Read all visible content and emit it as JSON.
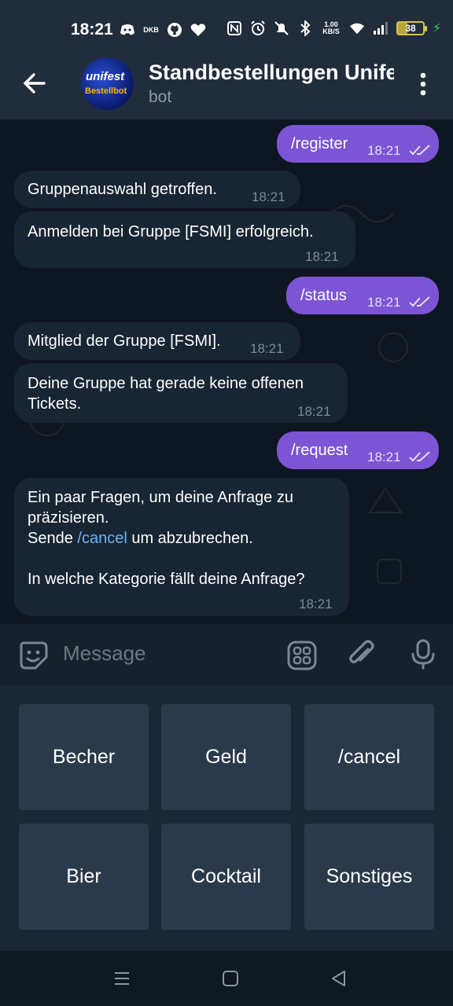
{
  "status_bar": {
    "time": "18:21",
    "dkb": "DKB",
    "speed_value": "1.00",
    "speed_unit": "KB/S",
    "battery": "38"
  },
  "header": {
    "title": "Standbestellungen Unifest",
    "subtitle": "bot",
    "avatar_line1": "unifest",
    "avatar_line2": "Bestellbot"
  },
  "messages": [
    {
      "dir": "out",
      "text": "/register",
      "time": "18:21"
    },
    {
      "dir": "in",
      "text": "Gruppenauswahl getroffen.",
      "time": "18:21"
    },
    {
      "dir": "in",
      "text": "Anmelden bei Gruppe [FSMI] erfolgreich.",
      "time": "18:21"
    },
    {
      "dir": "out",
      "text": "/status",
      "time": "18:21"
    },
    {
      "dir": "in",
      "text": "Mitglied der Gruppe [FSMI].",
      "time": "18:21"
    },
    {
      "dir": "in",
      "line1": "Deine Gruppe hat gerade keine offenen",
      "line2": "Tickets.",
      "time": "18:21"
    },
    {
      "dir": "out",
      "text": "/request",
      "time": "18:21"
    },
    {
      "dir": "in",
      "line1": "Ein paar Fragen, um deine Anfrage zu",
      "line2": "präzisieren.",
      "line3_prefix": "Sende ",
      "line3_link": "/cancel",
      "line3_suffix": " um abzubrechen.",
      "line4": "In welche Kategorie fällt deine Anfrage?",
      "time": "18:21"
    }
  ],
  "composer": {
    "placeholder": "Message"
  },
  "keyboard": {
    "row1": [
      "Becher",
      "Geld",
      "/cancel"
    ],
    "row2": [
      "Bier",
      "Cocktail",
      "Sonstiges"
    ]
  }
}
